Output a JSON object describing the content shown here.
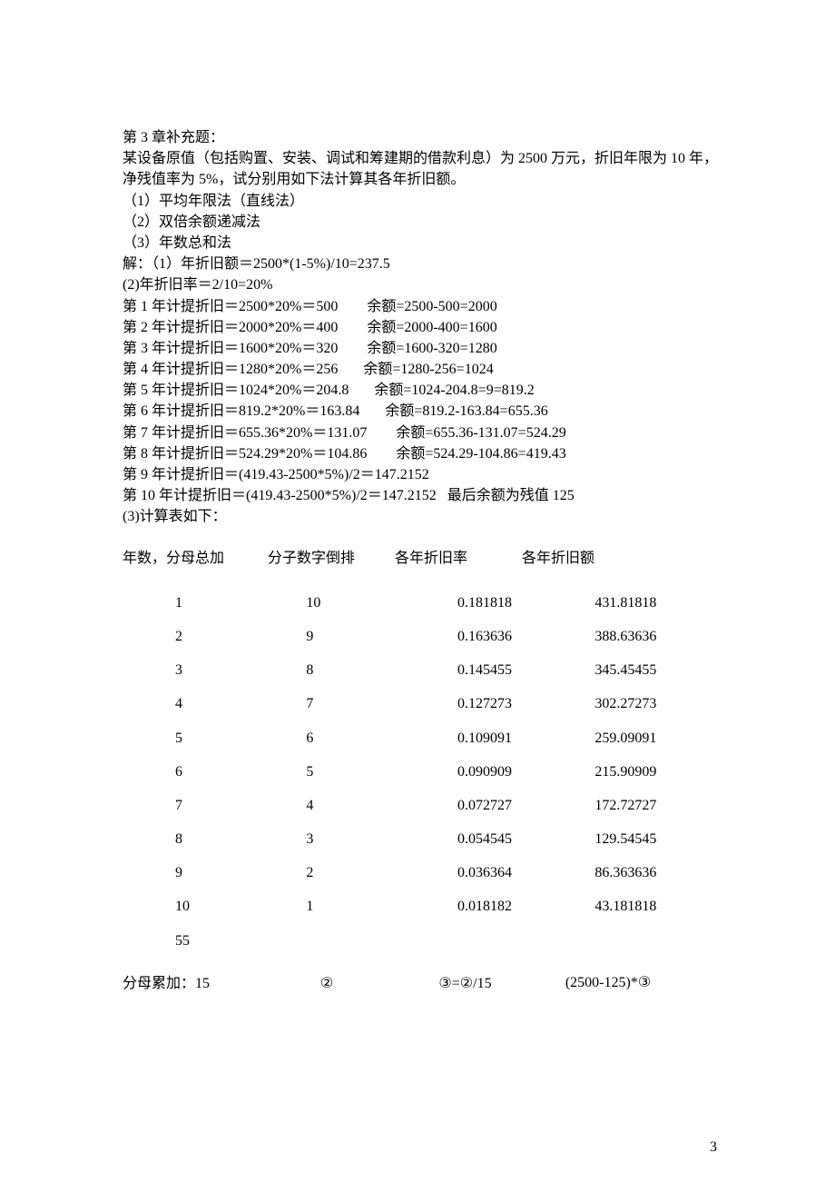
{
  "title": "第 3 章补充题：",
  "problem": [
    "某设备原值（包括购置、安装、调试和筹建期的借款利息）为 2500 万元，折旧年限为 10 年，",
    "净残值率为 5%，试分别用如下法计算其各年折旧额。",
    "（1）平均年限法（直线法）",
    "（2）双倍余额递减法",
    "（3）年数总和法"
  ],
  "solution_intro": "解：（1）年折旧额＝2500*(1-5%)/10=237.5",
  "m2": [
    "(2)年折旧率＝2/10=20%",
    "第 1 年计提折旧＝2500*20%＝500        余额=2500-500=2000",
    "第 2 年计提折旧＝2000*20%＝400        余额=2000-400=1600",
    "第 3 年计提折旧＝1600*20%＝320        余额=1600-320=1280",
    "第 4 年计提折旧＝1280*20%＝256       余额=1280-256=1024",
    "第 5 年计提折旧＝1024*20%＝204.8       余额=1024-204.8=9=819.2",
    "第 6 年计提折旧＝819.2*20%＝163.84       余额=819.2-163.84=655.36",
    "第 7 年计提折旧＝655.36*20%＝131.07        余额=655.36-131.07=524.29",
    "第 8 年计提折旧＝524.29*20%＝104.86        余额=524.29-104.86=419.43",
    "第 9 年计提折旧＝(419.43-2500*5%)/2＝147.2152",
    "第 10 年计提折旧＝(419.43-2500*5%)/2＝147.2152   最后余额为残值 125"
  ],
  "m3_intro": "(3)计算表如下：",
  "table": {
    "headers": [
      "年数，分母总加",
      "分子数字倒排",
      "各年折旧率",
      "各年折旧额"
    ],
    "rows": [
      {
        "c1": "1",
        "c2": "10",
        "c3": "0.181818",
        "c4": "431.81818"
      },
      {
        "c1": "2",
        "c2": "9",
        "c3": "0.163636",
        "c4": "388.63636"
      },
      {
        "c1": "3",
        "c2": "8",
        "c3": "0.145455",
        "c4": "345.45455"
      },
      {
        "c1": "4",
        "c2": "7",
        "c3": "0.127273",
        "c4": "302.27273"
      },
      {
        "c1": "5",
        "c2": "6",
        "c3": "0.109091",
        "c4": "259.09091"
      },
      {
        "c1": "6",
        "c2": "5",
        "c3": "0.090909",
        "c4": "215.90909"
      },
      {
        "c1": "7",
        "c2": "4",
        "c3": "0.072727",
        "c4": "172.72727"
      },
      {
        "c1": "8",
        "c2": "3",
        "c3": "0.054545",
        "c4": "129.54545"
      },
      {
        "c1": "9",
        "c2": "2",
        "c3": "0.036364",
        "c4": "86.363636"
      },
      {
        "c1": "10",
        "c2": "1",
        "c3": "0.018182",
        "c4": "43.181818"
      }
    ],
    "sum_row": "55",
    "footer": {
      "f1": "分母累加：15",
      "f2": "②",
      "f3": "③=②/15",
      "f4": "(2500-125)*③"
    }
  },
  "page_number": "3"
}
